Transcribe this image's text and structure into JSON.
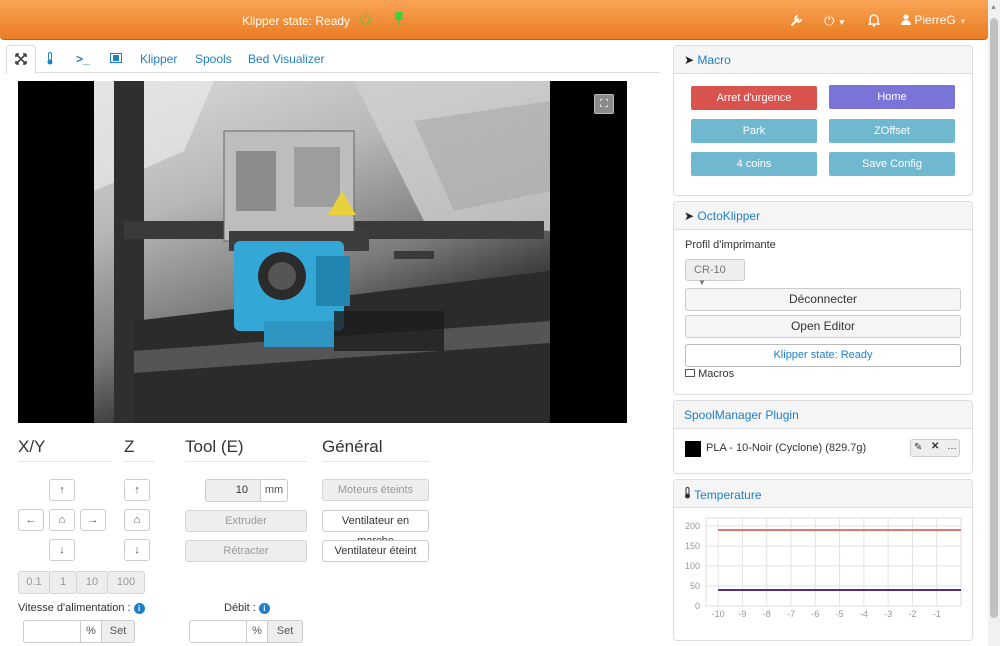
{
  "navbar": {
    "state_label": "Klipper state: Ready",
    "user_name": "PierreG",
    "icons": [
      "wrench-icon",
      "power-icon",
      "bell-icon",
      "user-icon",
      "bolt-icon",
      "pin-icon"
    ]
  },
  "tabs": [
    {
      "icon": "expand-icon",
      "label": ""
    },
    {
      "icon": "thermometer-icon",
      "label": ""
    },
    {
      "icon": "terminal-icon",
      "label": ""
    },
    {
      "icon": "film-icon",
      "label": ""
    },
    {
      "icon": "",
      "label": "Klipper"
    },
    {
      "icon": "",
      "label": "Spools"
    },
    {
      "icon": "",
      "label": "Bed Visualizer"
    }
  ],
  "controls": {
    "xy_title": "X/Y",
    "z_title": "Z",
    "tool_title": "Tool (E)",
    "general_title": "Général",
    "distances": [
      "0.1",
      "1",
      "10",
      "100"
    ],
    "extrude_amount": "10",
    "extrude_unit": "mm",
    "extrude_label": "Extruder",
    "retract_label": "Rétracter",
    "motors_off_label": "Moteurs éteints",
    "fan_on_label": "Ventilateur en marche",
    "fan_off_label": "Ventilateur éteint",
    "feed_rate_label": "Vitesse d'alimentation :",
    "flow_rate_label": "Débit :",
    "percent_unit": "%",
    "set_label": "Set"
  },
  "macro_panel": {
    "title": "Macro",
    "buttons": [
      {
        "label": "Arret d'urgence",
        "color": "#d9534f"
      },
      {
        "label": "Home",
        "color": "#7a74d8"
      },
      {
        "label": "Park",
        "color": "#6fb8cf"
      },
      {
        "label": "ZOffset",
        "color": "#6fb8cf"
      },
      {
        "label": "4 coins",
        "color": "#6fb8cf"
      },
      {
        "label": "Save Config",
        "color": "#6fb8cf"
      }
    ]
  },
  "octoklipper_panel": {
    "title": "OctoKlipper",
    "profile_label": "Profil d'imprimante",
    "profile_value": "CR-10",
    "disconnect_label": "Déconnecter",
    "open_editor_label": "Open Editor",
    "state_text": "Klipper state: Ready",
    "macros_label": "Macros"
  },
  "spool_panel": {
    "title": "SpoolManager Plugin",
    "spool_label": "PLA - 10-Noir (Cyclone) (829.7g)",
    "spool_color": "#000000"
  },
  "temperature_panel": {
    "title": "Temperature"
  },
  "chart_data": {
    "type": "line",
    "x": [
      -10,
      -9,
      -8,
      -7,
      -6,
      -5,
      -4,
      -3,
      -2,
      -1,
      0
    ],
    "xlim": [
      -10.5,
      0
    ],
    "ylim": [
      0,
      220
    ],
    "yticks": [
      "0",
      "50",
      "100",
      "150",
      "200"
    ],
    "xticks": [
      "-10",
      "-9",
      "-8",
      "-7",
      "-6",
      "-5",
      "-4",
      "-3",
      "-2",
      "-1"
    ],
    "grid": true,
    "series": [
      {
        "color": "#e57373",
        "values": [
          190,
          190,
          190,
          190,
          190,
          190,
          190,
          190,
          190,
          190,
          190
        ]
      },
      {
        "color": "#5b2a86",
        "values": [
          40,
          40,
          40,
          40,
          40,
          40,
          40,
          40,
          40,
          40,
          40
        ]
      }
    ]
  }
}
